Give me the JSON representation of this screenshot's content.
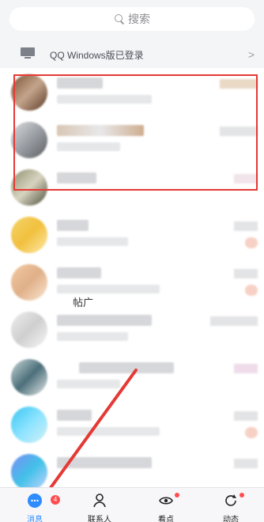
{
  "search": {
    "placeholder": "搜索"
  },
  "login_banner": {
    "text": "QQ Windows版已登录"
  },
  "chat_list": {
    "rows": [
      {
        "visible_name": ""
      },
      {
        "visible_name": ""
      },
      {
        "visible_name": ""
      },
      {
        "visible_name": ""
      },
      {
        "visible_name": ""
      },
      {
        "visible_name": ""
      },
      {
        "visible_name": "帖广"
      },
      {
        "visible_name": ""
      },
      {
        "visible_name": ""
      }
    ]
  },
  "tabs": [
    {
      "label": "消息",
      "badge": "4",
      "active": true
    },
    {
      "label": "联系人"
    },
    {
      "label": "看点"
    },
    {
      "label": "动态"
    }
  ],
  "colors": {
    "accent": "#2d8cff",
    "annotation_red": "#e53935",
    "badge_red": "#ff4d4f"
  }
}
